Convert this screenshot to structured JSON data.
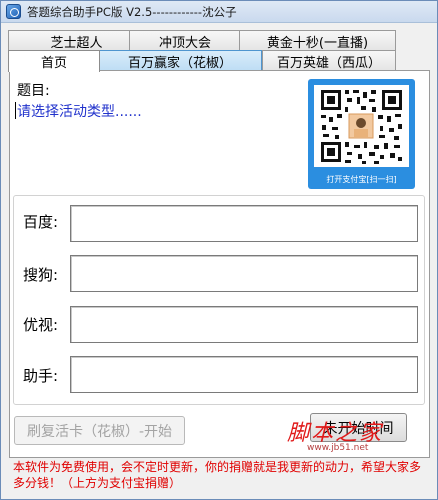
{
  "window": {
    "title": "答题综合助手PC版 V2.5------------沈公子"
  },
  "tabs_top": [
    {
      "label": "芝士超人"
    },
    {
      "label": "冲顶大会"
    },
    {
      "label": "黄金十秒(一直播)"
    }
  ],
  "tabs_bottom": [
    {
      "label": "首页"
    },
    {
      "label": "百万赢家（花椒）"
    },
    {
      "label": "百万英雄（西瓜）"
    }
  ],
  "main": {
    "question_label": "题目:",
    "question_text": "请选择活动类型......",
    "qr_caption": "打开支付宝[扫一扫]"
  },
  "fields": [
    {
      "label": "百度:",
      "value": ""
    },
    {
      "label": "搜狗:",
      "value": ""
    },
    {
      "label": "优视:",
      "value": ""
    },
    {
      "label": "助手:",
      "value": ""
    }
  ],
  "buttons": {
    "refresh": "刷复活卡（花椒）-开始",
    "start_time": "未开始时间"
  },
  "watermark": {
    "text": "脚本之家",
    "url": "www.jb51.net"
  },
  "notice": "本软件为免费使用，会不定时更新，你的捐赠就是我更新的动力，希望大家多多分钱！（上方为支付宝捐赠）",
  "colors": {
    "title_bar": "#c9d9ee",
    "accent_blue": "#2b8ee0",
    "notice_red": "#e00000",
    "question_blue": "#2233cc"
  }
}
